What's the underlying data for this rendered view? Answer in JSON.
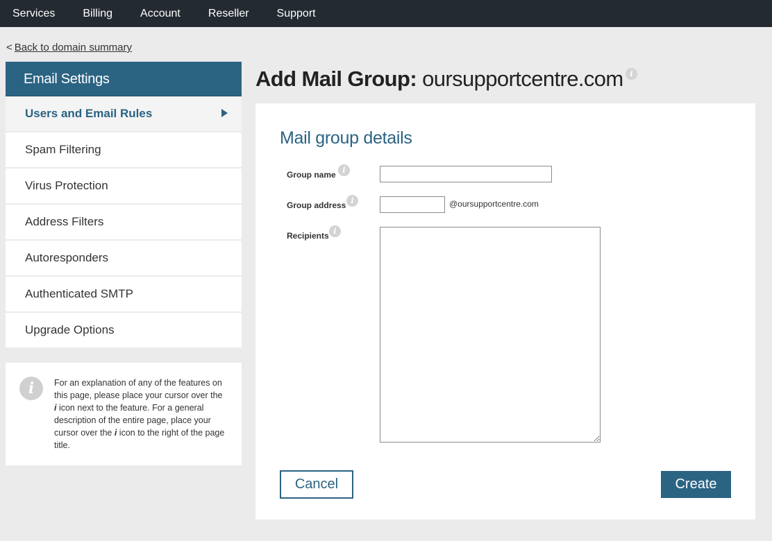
{
  "topnav": {
    "items": [
      {
        "label": "Services"
      },
      {
        "label": "Billing"
      },
      {
        "label": "Account"
      },
      {
        "label": "Reseller"
      },
      {
        "label": "Support"
      }
    ]
  },
  "back": {
    "prefix": "<",
    "label": "Back to domain summary"
  },
  "sidebar": {
    "title": "Email Settings",
    "items": [
      {
        "label": "Users and Email Rules",
        "active": true
      },
      {
        "label": "Spam Filtering"
      },
      {
        "label": "Virus Protection"
      },
      {
        "label": "Address Filters"
      },
      {
        "label": "Autoresponders"
      },
      {
        "label": "Authenticated SMTP"
      },
      {
        "label": "Upgrade Options"
      }
    ]
  },
  "info": {
    "icon_glyph": "i",
    "text_part1": "For an explanation of any of the features on this page, please place your cursor over the ",
    "i1": "i",
    "text_part2": " icon next to the feature. For a general description of the entire page, place your cursor over the ",
    "i2": "i",
    "text_part3": " icon to the right of the page title."
  },
  "page": {
    "title_bold": "Add Mail Group:",
    "title_domain": "oursupportcentre.com",
    "info_glyph": "i"
  },
  "form": {
    "section_title": "Mail group details",
    "group_name": {
      "label": "Group name",
      "value": ""
    },
    "group_address": {
      "label": "Group address",
      "value": "",
      "suffix": "@oursupportcentre.com"
    },
    "recipients": {
      "label": "Recipients",
      "value": ""
    },
    "info_glyph": "i",
    "cancel_label": "Cancel",
    "create_label": "Create"
  },
  "colors": {
    "brand": "#2b6383",
    "topnav_bg": "#232a31",
    "page_bg": "#ebebeb"
  }
}
